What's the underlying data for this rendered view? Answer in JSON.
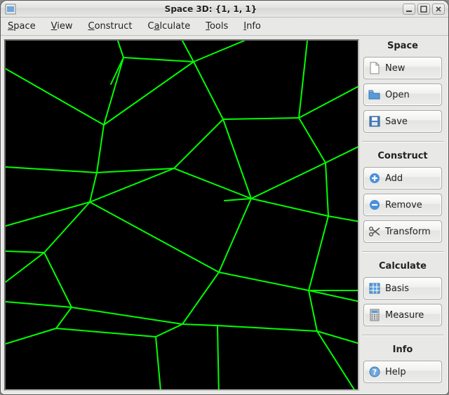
{
  "window": {
    "title": "Space 3D: {1, 1, 1}"
  },
  "menu": {
    "space": "Space",
    "view": "View",
    "construct": "Construct",
    "calculate": "Calculate",
    "tools": "Tools",
    "info": "Info"
  },
  "sections": {
    "space": "Space",
    "construct": "Construct",
    "calculate": "Calculate",
    "info": "Info"
  },
  "buttons": {
    "new": "New",
    "open": "Open",
    "save": "Save",
    "add": "Add",
    "remove": "Remove",
    "transform": "Transform",
    "basis": "Basis",
    "measure": "Measure",
    "help": "Help"
  }
}
